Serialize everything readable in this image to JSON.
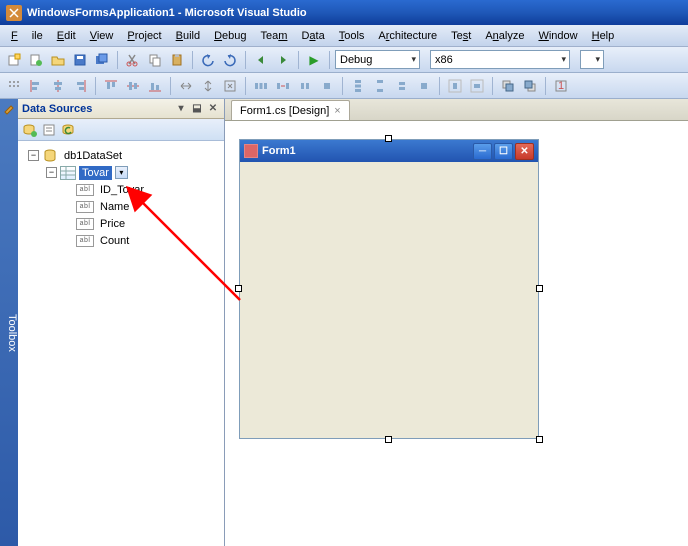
{
  "window": {
    "title": "WindowsFormsApplication1 - Microsoft Visual Studio"
  },
  "menu": {
    "file": "File",
    "edit": "Edit",
    "view": "View",
    "project": "Project",
    "build": "Build",
    "debug": "Debug",
    "team": "Team",
    "data": "Data",
    "tools": "Tools",
    "architecture": "Architecture",
    "test": "Test",
    "analyze": "Analyze",
    "window": "Window",
    "help": "Help"
  },
  "toolbar": {
    "config": "Debug",
    "platform": "x86"
  },
  "sidebar": {
    "toolbox": "Toolbox"
  },
  "panel": {
    "title": "Data Sources",
    "dataset": "db1DataSet",
    "table": "Tovar",
    "fields": [
      "ID_Tovar",
      "Name",
      "Price",
      "Count"
    ]
  },
  "tabs": {
    "active": "Form1.cs [Design]"
  },
  "form": {
    "title": "Form1"
  }
}
